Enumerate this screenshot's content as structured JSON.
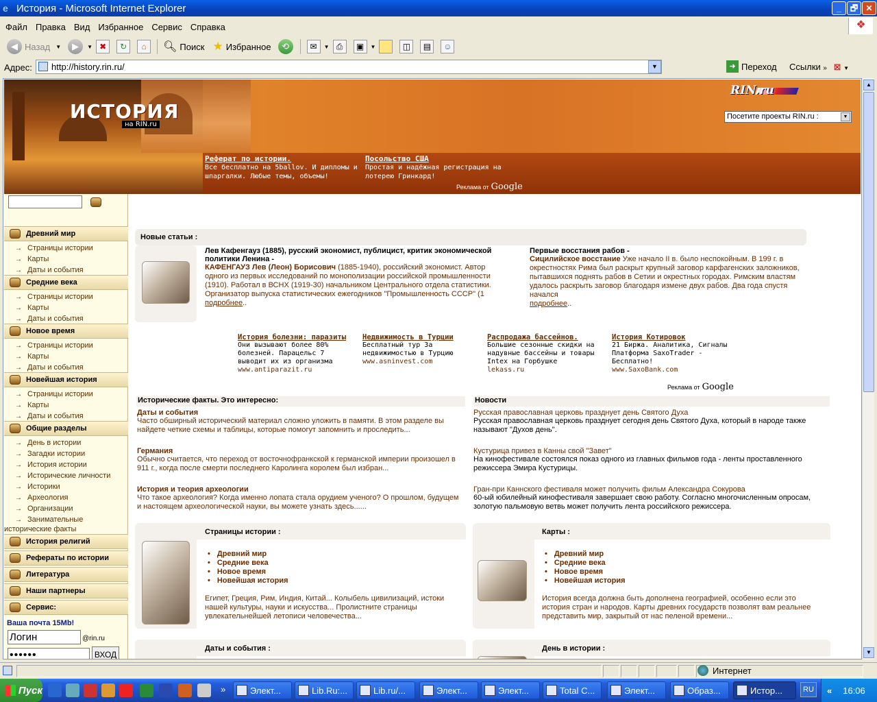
{
  "window": {
    "title": "История - Microsoft Internet Explorer",
    "min": "_",
    "max": "🗗",
    "close": "✕"
  },
  "menu": [
    "Файл",
    "Правка",
    "Вид",
    "Избранное",
    "Сервис",
    "Справка"
  ],
  "toolbar": {
    "back": "Назад",
    "search": "Поиск",
    "favorites": "Избранное"
  },
  "address": {
    "label": "Адрес:",
    "url": "http://history.rin.ru/",
    "go": "Переход",
    "links": "Ссылки"
  },
  "site": {
    "logo": "ИСТОРИЯ",
    "logo_sub": "на RIN.ru",
    "rin_logo": "RIN.ru",
    "rin_select": "Посетите проекты RIN.ru :",
    "header_ads": [
      {
        "title": "Реферат по истории.",
        "text": "Все бесплатно на 5ballov. И дипломы и шпаргалки. Любые темы, объемы!"
      },
      {
        "title": "Посольство США",
        "text": "Простая и надёжная регистрация на лотерею Гринкард!"
      }
    ],
    "ads_by": "Реклама от",
    "google": "Google"
  },
  "sidebar": {
    "sections": [
      {
        "title": "Древний мир",
        "links": [
          "Страницы истории",
          "Карты",
          "Даты и события"
        ]
      },
      {
        "title": "Средние века",
        "links": [
          "Страницы истории",
          "Карты",
          "Даты и события"
        ]
      },
      {
        "title": "Новое время",
        "links": [
          "Страницы истории",
          "Карты",
          "Даты и события"
        ]
      },
      {
        "title": "Новейшая история",
        "links": [
          "Страницы истории",
          "Карты",
          "Даты и события"
        ]
      },
      {
        "title": "Общие разделы",
        "links": [
          "День в истории",
          "Загадки истории",
          "История истории",
          "Исторические личности",
          "Историки",
          "Археология",
          "Организации",
          "Занимательные"
        ]
      }
    ],
    "last_link_cont": "исторические факты",
    "more_sections": [
      "История религий",
      "Рефераты по истории",
      "Литература",
      "Наши партнеры"
    ],
    "service": "Сервис:",
    "mail_label": "Ваша почта 15Mb!",
    "login": "Логин",
    "login_domain": "@rin.ru",
    "password": "••••••",
    "login_btn": "ВХОД"
  },
  "main": {
    "new_articles": {
      "header": "Новые статьи :",
      "left": {
        "title": "Лев Кафенгауз (1885), русский экономист, публицист, критик экономической политики Ленина -",
        "name": "КАФЕНГАУЗ Лев (Леон) Борисович",
        "text": "(1885-1940), российский экономист. Автор одного из первых исследований по монополизации российской промышленности (1910). Работал в ВСНХ (1919-30) начальником Центрального отдела статистики. Организатор выпуска статистических ежегодников \"Промышленность СССР\" (1",
        "more": "подробнее"
      },
      "right": {
        "title": "Первые восстания рабов -",
        "name": "Сицилийское восстание",
        "text": "Уже начало II в. было неспокойным. В 199 г. в окрестностях Рима был раскрыт крупный заговор карфагенских заложников, пытавшихся поднять рабов в Сетии и окрестных городах. Римским властям удалось раскрыть заговор благодаря измене двух рабов. Два года спустя начался",
        "more": "подробнее"
      }
    },
    "ads": [
      {
        "title": "История болезни: паразиты",
        "text": "Они вызывают более 80% болезней. Парацельс 7 выводит их из организма",
        "url": "www.antiparazit.ru"
      },
      {
        "title": "Недвижимость в Турции",
        "text": "Бесплатный тур За недвижимостью в Турцию",
        "url": "www.asninvest.com"
      },
      {
        "title": "Распродажа бассейнов.",
        "text": "Большие сезонные скидки на надувные бассейны и товары Intex на Горбушке",
        "url": "lekass.ru"
      },
      {
        "title": "История Котировок",
        "text": "21 Биржа. Аналитика, Сигналы Платформа SaxoTrader - Бесплатно!",
        "url": "www.SaxoBank.com"
      }
    ],
    "facts": {
      "header": "Исторические факты. Это интересно:",
      "items": [
        {
          "title": "Даты и события",
          "text": "Часто обширный исторический материал сложно уложить в памяти. В этом разделе вы найдете четкие схемы и таблицы, которые помогут запомнить и проследить..."
        },
        {
          "title": "Германия",
          "text": "Обычно считается, что переход от восточнофранкской к германской империи произошел в 911 г., когда после смерти последнего Каролинга королем был избран..."
        },
        {
          "title": "История и теория археологии",
          "text": "Что такое археология? Когда именно лопата стала орудием ученого? О прошлом, будущем и настоящем археологической науки, вы можете узнать здесь......"
        }
      ]
    },
    "news": {
      "header": "Новости",
      "items": [
        {
          "title": "Русская православная церковь празднует день Святого Духа",
          "text": "Русская православная церковь празднует сегодня день Святого Духа, который в народе также называют \"Духов день\"."
        },
        {
          "title": "Кустурица привез в Канны свой \"Завет\"",
          "text": "На кинофестивале состоялся показ одного из главных фильмов года - ленты проставленного режиссера Эмира Кустурицы."
        },
        {
          "title": "Гран-при Каннского фестиваля может получить фильм Александра Сокурова",
          "text": "60-ый юбилейный кинофестиваля завершает свою работу. Согласно многочисленным опросам, золотую пальмовую ветвь может получить лента российского режиссера."
        }
      ]
    },
    "pages": {
      "header": "Страницы истории :",
      "items": [
        "Древний мир",
        "Средние века",
        "Новое время",
        "Новейшая история"
      ],
      "text": "Египет, Греция, Рим, Индия, Китай... Колыбель цивилизаций, истоки нашей культуры, науки и искусства... Пролистните страницы увлекательнейшей летописи человечества..."
    },
    "maps": {
      "header": "Карты :",
      "items": [
        "Древний мир",
        "Средние века",
        "Новое время",
        "Новейшая история"
      ],
      "text": "История всегда должна быть дополнена географией, особенно если это история стран и народов. Карты древних государств позволят вам реальнее представить мир, закрытый от нас пеленой времени..."
    },
    "dates_header": "Даты и события :",
    "day_header": "День в истории :"
  },
  "status": {
    "zone": "Интернет"
  },
  "taskbar": {
    "start": "Пуск",
    "tasks": [
      "Элект...",
      "Lib.Ru:...",
      "Lib.ru/...",
      "Элект...",
      "Элект...",
      "Total C...",
      "Элект...",
      "Образ...",
      "Истор..."
    ],
    "lang": "RU",
    "chevron": "«",
    "clock": "16:06"
  }
}
